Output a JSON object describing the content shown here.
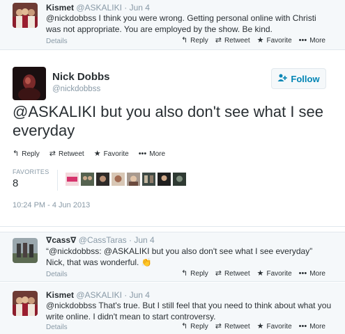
{
  "tweets_above": [
    {
      "name": "Kismet",
      "handle": "@ASKALIKI",
      "time": "· Jun 4",
      "text": "@nickdobbss I think you were wrong. Getting personal online with Christi was not appropriate. You are employed by the show. Be kind.",
      "details": "Details"
    }
  ],
  "actions": {
    "reply": "Reply",
    "retweet": "Retweet",
    "favorite": "Favorite",
    "more": "More"
  },
  "icons": {
    "reply": "reply-arrow-icon",
    "retweet": "retweet-icon",
    "favorite": "star-icon",
    "more": "ellipsis-icon",
    "follow": "add-user-icon"
  },
  "main_tweet": {
    "name": "Nick Dobbs",
    "handle": "@nickdobbss",
    "follow_label": "Follow",
    "text": "@ASKALIKI but you also don't see what I see everyday",
    "favorites_label": "FAVORITES",
    "favorites_count": "8",
    "timestamp": "10:24 PM - 4 Jun 2013"
  },
  "replies": [
    {
      "name": "∇cass∇",
      "handle": "@CassTaras",
      "time": "· Jun 4",
      "text": "“@nickdobbss: @ASKALIKI but you also don't see what I see everyday” Nick, that was wonderful. 👏",
      "details": "Details"
    },
    {
      "name": "Kismet",
      "handle": "@ASKALIKI",
      "time": "· Jun 4",
      "text": "@nickdobbss That's true. But I still feel that you need to think about what you write online. I didn't mean to start controversy.",
      "details": "Details"
    }
  ],
  "colors": {
    "link_blue": "#0084b4",
    "muted": "#8899a6",
    "text": "#292f33"
  }
}
